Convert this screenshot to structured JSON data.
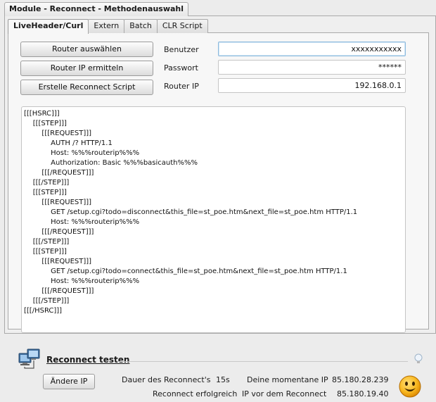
{
  "window": {
    "title": "Module - Reconnect - Methodenauswahl"
  },
  "tabs": [
    {
      "label": "LiveHeader/Curl",
      "active": true
    },
    {
      "label": "Extern"
    },
    {
      "label": "Batch"
    },
    {
      "label": "CLR Script"
    }
  ],
  "buttons": {
    "select_router": "Router auswählen",
    "detect_router_ip": "Router IP ermitteln",
    "create_script": "Erstelle Reconnect Script",
    "change_ip": "Ändere IP"
  },
  "form": {
    "user_label": "Benutzer",
    "user_value": "xxxxxxxxxxx",
    "password_label": "Passwort",
    "password_value": "******",
    "router_ip_label": "Router IP",
    "router_ip_value": "192.168.0.1"
  },
  "script": {
    "lines": [
      "[[[HSRC]]]",
      "    [[[STEP]]]",
      "        [[[REQUEST]]]",
      "            AUTH /? HTTP/1.1",
      "            Host: %%%routerip%%%",
      "            Authorization: Basic %%%basicauth%%%",
      "        [[[/REQUEST]]]",
      "    [[[/STEP]]]",
      "    [[[STEP]]]",
      "        [[[REQUEST]]]",
      "            GET /setup.cgi?todo=disconnect&this_file=st_poe.htm&next_file=st_poe.htm HTTP/1.1",
      "            Host: %%%routerip%%%",
      "        [[[/REQUEST]]]",
      "    [[[/STEP]]]",
      "    [[[STEP]]]",
      "        [[[REQUEST]]]",
      "            GET /setup.cgi?todo=connect&this_file=st_poe.htm&next_file=st_poe.htm HTTP/1.1",
      "            Host: %%%routerip%%%",
      "        [[[/REQUEST]]]",
      "    [[[/STEP]]]",
      "[[[/HSRC]]]"
    ]
  },
  "reconnect": {
    "title": "Reconnect testen",
    "duration_label": "Dauer des Reconnect's",
    "duration_value": "15s",
    "current_ip_label": "Deine momentane IP",
    "current_ip_value": "85.180.28.239",
    "status_text": "Reconnect erfolgreich",
    "previous_ip_label": "IP vor dem Reconnect",
    "previous_ip_value": "85.180.19.40"
  },
  "icons": {
    "network": "network-computers-icon",
    "hint": "lightbulb-icon",
    "status": "smiley-icon"
  },
  "colors": {
    "focus_border": "#8ebbde",
    "smiley": "#f5a400"
  }
}
